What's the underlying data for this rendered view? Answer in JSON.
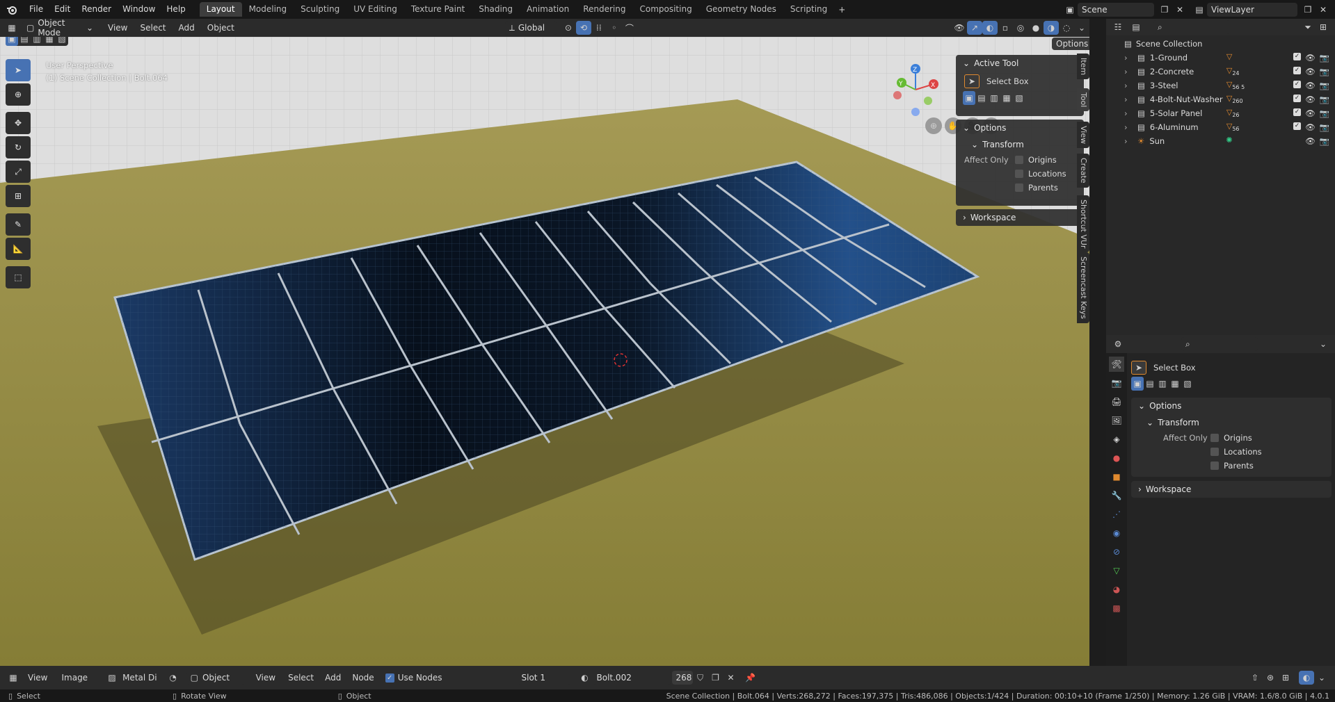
{
  "menu": [
    "File",
    "Edit",
    "Render",
    "Window",
    "Help"
  ],
  "workspaces": [
    "Layout",
    "Modeling",
    "Sculpting",
    "UV Editing",
    "Texture Paint",
    "Shading",
    "Animation",
    "Rendering",
    "Compositing",
    "Geometry Nodes",
    "Scripting"
  ],
  "active_workspace": "Layout",
  "scene_name": "Scene",
  "view_layer": "ViewLayer",
  "viewport_header": {
    "mode": "Object Mode",
    "menus": [
      "View",
      "Select",
      "Add",
      "Object"
    ],
    "orientation": "Global",
    "options_label": "Options"
  },
  "viewport": {
    "perspective_label": "User Perspective",
    "collection_label": "(1) Scene Collection | Bolt.064"
  },
  "npanel": {
    "active_tool_title": "Active Tool",
    "tool_name": "Select Box",
    "options_title": "Options",
    "transform_title": "Transform",
    "affect_only_label": "Affect Only",
    "checkboxes": [
      "Origins",
      "Locations",
      "Parents"
    ],
    "workspace_title": "Workspace",
    "side_tabs": [
      "Item",
      "Tool",
      "View",
      "Create",
      "Shortcut VUr",
      "Screencast Keys"
    ]
  },
  "outliner": {
    "root": "Scene Collection",
    "items": [
      {
        "name": "1-Ground",
        "badge": ""
      },
      {
        "name": "2-Concrete",
        "badge": "24"
      },
      {
        "name": "3-Steel",
        "badge": "56 5"
      },
      {
        "name": "4-Bolt-Nut-Washer",
        "badge": "260"
      },
      {
        "name": "5-Solar Panel",
        "badge": "26"
      },
      {
        "name": "6-Aluminum",
        "badge": "56"
      },
      {
        "name": "Sun",
        "badge": ""
      }
    ]
  },
  "properties": {
    "tool_name": "Select Box",
    "options_title": "Options",
    "transform_title": "Transform",
    "affect_only_label": "Affect Only",
    "checkboxes": [
      "Origins",
      "Locations",
      "Parents"
    ],
    "workspace_title": "Workspace"
  },
  "shader_header": {
    "menus_left": [
      "View",
      "Image"
    ],
    "material_short": "Metal Di",
    "object_dropdown": "Object",
    "menus": [
      "View",
      "Select",
      "Add",
      "Node"
    ],
    "use_nodes_label": "Use Nodes",
    "slot": "Slot 1",
    "material_name": "Bolt.002",
    "users": "268"
  },
  "status": {
    "left_action": "Select",
    "middle_action": "Rotate View",
    "right_action": "Object",
    "stats": "Scene Collection | Bolt.064 | Verts:268,272 | Faces:197,375 | Tris:486,086 | Objects:1/424 | Duration: 00:10+10 (Frame 1/250) | Memory: 1.26 GiB | VRAM: 1.6/8.0 GiB | 4.0.1"
  },
  "colors": {
    "accent": "#4772b3",
    "ground": "#8f8a3f",
    "panel_cell": "#0f2238",
    "orange_icon": "#e08a2f"
  }
}
